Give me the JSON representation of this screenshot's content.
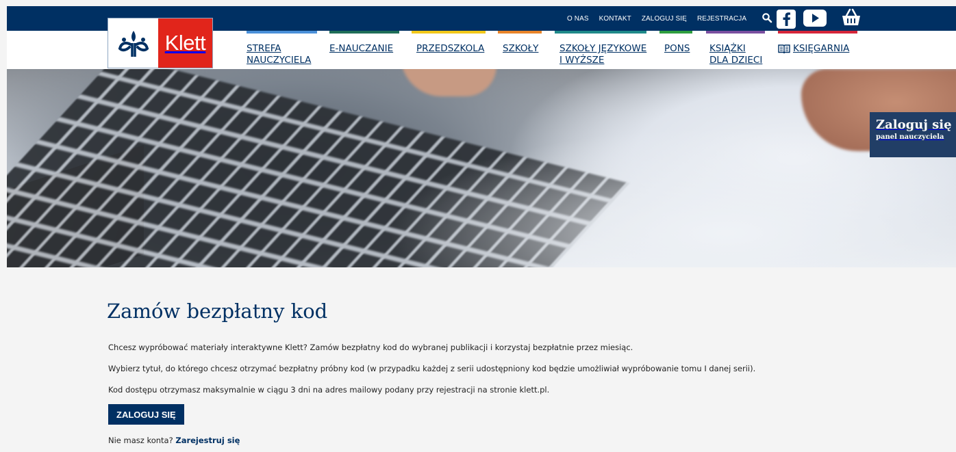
{
  "top_nav": {
    "links": [
      "O NAS",
      "KONTAKT",
      "ZALOGUJ SIĘ",
      "REJESTRACJA"
    ],
    "icons": [
      "search-icon",
      "facebook-icon",
      "youtube-icon",
      "basket-icon"
    ]
  },
  "logo": {
    "text": "Klett"
  },
  "main_nav": [
    {
      "line1": "STREFA",
      "line2": "NAUCZYCIELA",
      "color": "#4a90d9"
    },
    {
      "line1": "E-NAUCZANIE",
      "line2": "",
      "color": "#1f6e58"
    },
    {
      "line1": "PRZEDSZKOLA",
      "line2": "",
      "color": "#f2c81a"
    },
    {
      "line1": "SZKOŁY",
      "line2": "",
      "color": "#e8842a"
    },
    {
      "line1": "SZKOŁY JĘZYKOWE",
      "line2": "I WYŻSZE",
      "color": "#1f8a8a"
    },
    {
      "line1": "PONS",
      "line2": "",
      "color": "#2e9e3f"
    },
    {
      "line1": "KSIĄŻKI",
      "line2": "DLA DZIECI",
      "color": "#7a4fa0"
    },
    {
      "line1": "KSIĘGARNIA",
      "line2": "",
      "color": "#d5263a"
    }
  ],
  "login_tab": {
    "title": "Zaloguj się",
    "subtitle": "panel nauczyciela"
  },
  "content": {
    "heading": "Zamów bezpłatny kod",
    "p1": "Chcesz wypróbować materiały interaktywne Klett? Zamów bezpłatny kod do wybranej publikacji i korzystaj bezpłatnie przez miesiąc.",
    "p2": "Wybierz tytuł, do którego chcesz otrzymać bezpłatny próbny kod (w przypadku każdej z serii udostępniony kod będzie umożliwiał wypróbowanie tomu I danej serii).",
    "p3": "Kod dostępu otrzymasz maksymalnie w ciągu 3 dni na adres mailowy podany przy rejestracji na stronie klett.pl.",
    "button": "ZALOGUJ SIĘ",
    "no_account": "Nie masz konta?",
    "register_link": "Zarejestruj się"
  }
}
